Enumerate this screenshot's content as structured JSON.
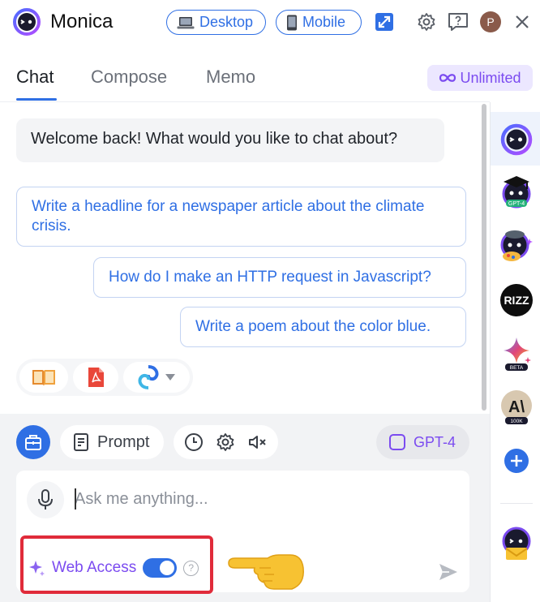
{
  "header": {
    "brand": "Monica",
    "desktop_label": "Desktop",
    "mobile_label": "Mobile",
    "avatar_initial": "P"
  },
  "tabs": [
    {
      "label": "Chat",
      "active": true
    },
    {
      "label": "Compose",
      "active": false
    },
    {
      "label": "Memo",
      "active": false
    }
  ],
  "plan_badge": "Unlimited",
  "chat": {
    "welcome": "Welcome back! What would you like to chat about?",
    "suggestions": [
      "Write a headline for a newspaper article about the climate crisis.",
      "How do I make an HTTP request in Javascript?",
      "Write a poem about the color blue."
    ]
  },
  "toolbar": {
    "prompt_label": "Prompt",
    "model_label": "GPT-4"
  },
  "input": {
    "placeholder": "Ask me anything..."
  },
  "web_access": {
    "label": "Web Access",
    "enabled": true
  },
  "rail": {
    "items": [
      "monica-bot",
      "gpt-4-bot",
      "artist-bot",
      "rizz-bot",
      "gemini-beta-bot",
      "claude-100k-bot",
      "add-bot",
      "mail-bot"
    ],
    "labels": {
      "gpt4_tag": "GPT-4",
      "rizz": "RIZZ",
      "beta_tag": "BETA",
      "claude_letters": "A\\",
      "claude_tag": "100K"
    }
  },
  "colors": {
    "accent": "#2f6fe4",
    "purple": "#7b4bf0",
    "highlight_box": "#e02b3a"
  }
}
